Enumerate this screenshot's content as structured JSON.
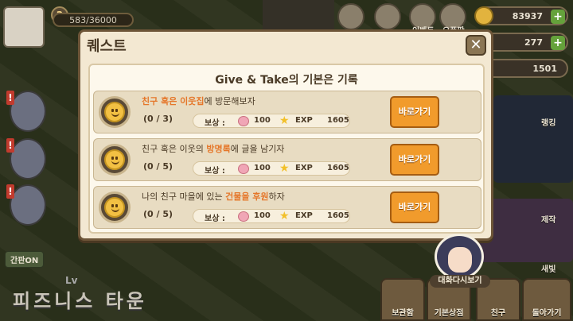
{
  "hud": {
    "level": "2",
    "xp_text": "583/36000",
    "coins": "83937",
    "hearts": "277",
    "points": "1501"
  },
  "top_icons": {
    "event_label": "이벤트",
    "oz_label": "오픈팟"
  },
  "side": {
    "page_button": "간판ON",
    "level_prefix": "Lv"
  },
  "town_title": "피즈니스 타운",
  "bottom_bar": [
    {
      "label": "보관함"
    },
    {
      "label": "기본상점"
    },
    {
      "label": "친구"
    },
    {
      "label": "돌아가기"
    }
  ],
  "right_side": {
    "ranking_label": "랭킹",
    "craft_label": "제작",
    "new_label": "새빛"
  },
  "quest_panel": {
    "title": "퀘스트",
    "subtitle": "Give & Take의 기본은 기록",
    "close_glyph": "✕",
    "quests": [
      {
        "text_before": "",
        "highlight": "친구 혹은 이웃집",
        "text_after": "에 방문해보자",
        "progress": "(0 / 3)",
        "reward_label": "보상 :",
        "coin": "100",
        "exp_label": "EXP",
        "exp": "1605",
        "button": "바로가기"
      },
      {
        "text_before": "친구 혹은 이웃의 ",
        "highlight": "방명록",
        "text_after": "에 글을 남기자",
        "progress": "(0 / 5)",
        "reward_label": "보상 :",
        "coin": "100",
        "exp_label": "EXP",
        "exp": "1605",
        "button": "바로가기"
      },
      {
        "text_before": "나의 친구 마을에 있는 ",
        "highlight": "건물을 후원",
        "text_after": "하자",
        "progress": "(0 / 5)",
        "reward_label": "보상 :",
        "coin": "100",
        "exp_label": "EXP",
        "exp": "1605",
        "button": "바로가기"
      }
    ]
  },
  "npc": {
    "label": "대화다시보기"
  },
  "colors": {
    "panel_bg": "#f3e8d2",
    "highlight": "#e5772a",
    "button": "#f19b2c"
  }
}
